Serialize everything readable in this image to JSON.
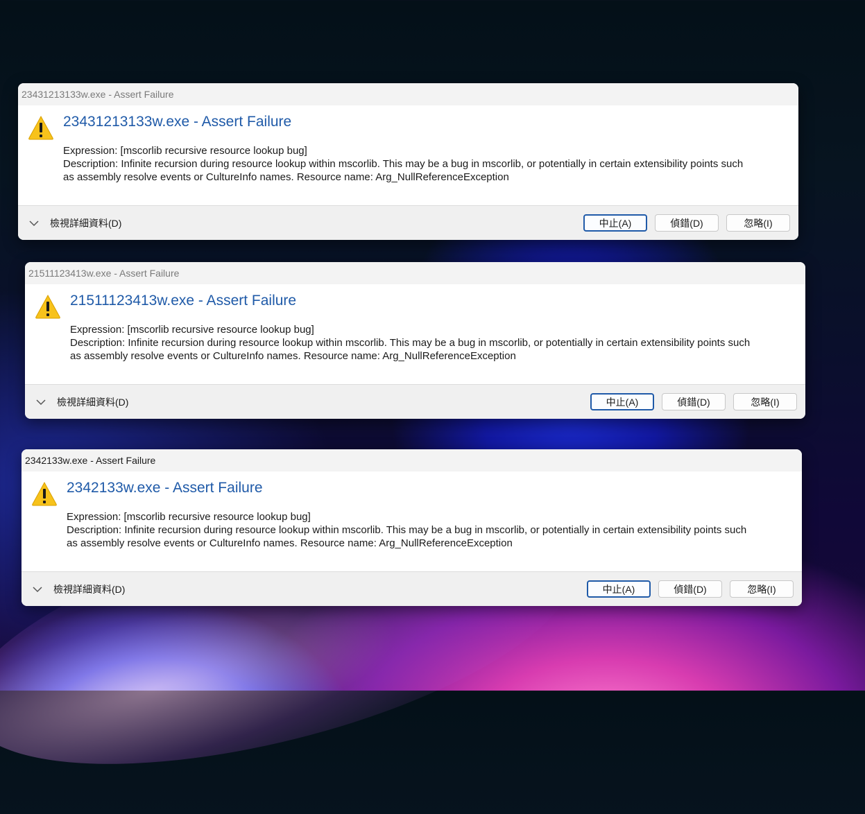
{
  "dialogs": [
    {
      "window_title": "23431213133w.exe - Assert Failure",
      "heading": "23431213133w.exe - Assert Failure",
      "message_line1": "Expression: [mscorlib recursive resource lookup bug]",
      "message_line2": "Description: Infinite recursion during resource lookup within mscorlib.  This may be a bug in mscorlib, or potentially in certain extensibility points such",
      "message_line3": "as assembly resolve events or CultureInfo names.  Resource name: Arg_NullReferenceException",
      "details_label": "檢視詳細資料(D)",
      "abort_label": "中止(A)",
      "debug_label": "偵錯(D)",
      "ignore_label": "忽略(I)"
    },
    {
      "window_title": "21511123413w.exe - Assert Failure",
      "heading": "21511123413w.exe - Assert Failure",
      "message_line1": "Expression: [mscorlib recursive resource lookup bug]",
      "message_line2": "Description: Infinite recursion during resource lookup within mscorlib.  This may be a bug in mscorlib, or potentially in certain extensibility points such",
      "message_line3": "as assembly resolve events or CultureInfo names.  Resource name: Arg_NullReferenceException",
      "details_label": "檢視詳細資料(D)",
      "abort_label": "中止(A)",
      "debug_label": "偵錯(D)",
      "ignore_label": "忽略(I)"
    },
    {
      "window_title": "2342133w.exe - Assert Failure",
      "heading": "2342133w.exe - Assert Failure",
      "message_line1": "Expression: [mscorlib recursive resource lookup bug]",
      "message_line2": "Description: Infinite recursion during resource lookup within mscorlib.  This may be a bug in mscorlib, or potentially in certain extensibility points such",
      "message_line3": "as assembly resolve events or CultureInfo names.  Resource name: Arg_NullReferenceException",
      "details_label": "檢視詳細資料(D)",
      "abort_label": "中止(A)",
      "debug_label": "偵錯(D)",
      "ignore_label": "忽略(I)"
    }
  ],
  "icons": {
    "dialog_icon": "warning-icon",
    "expand_icon": "chevron-down-icon"
  },
  "colors": {
    "heading": "#1f5aa8",
    "warning_fill": "#f7c21b",
    "default_button_border": "#1f5aa8"
  }
}
